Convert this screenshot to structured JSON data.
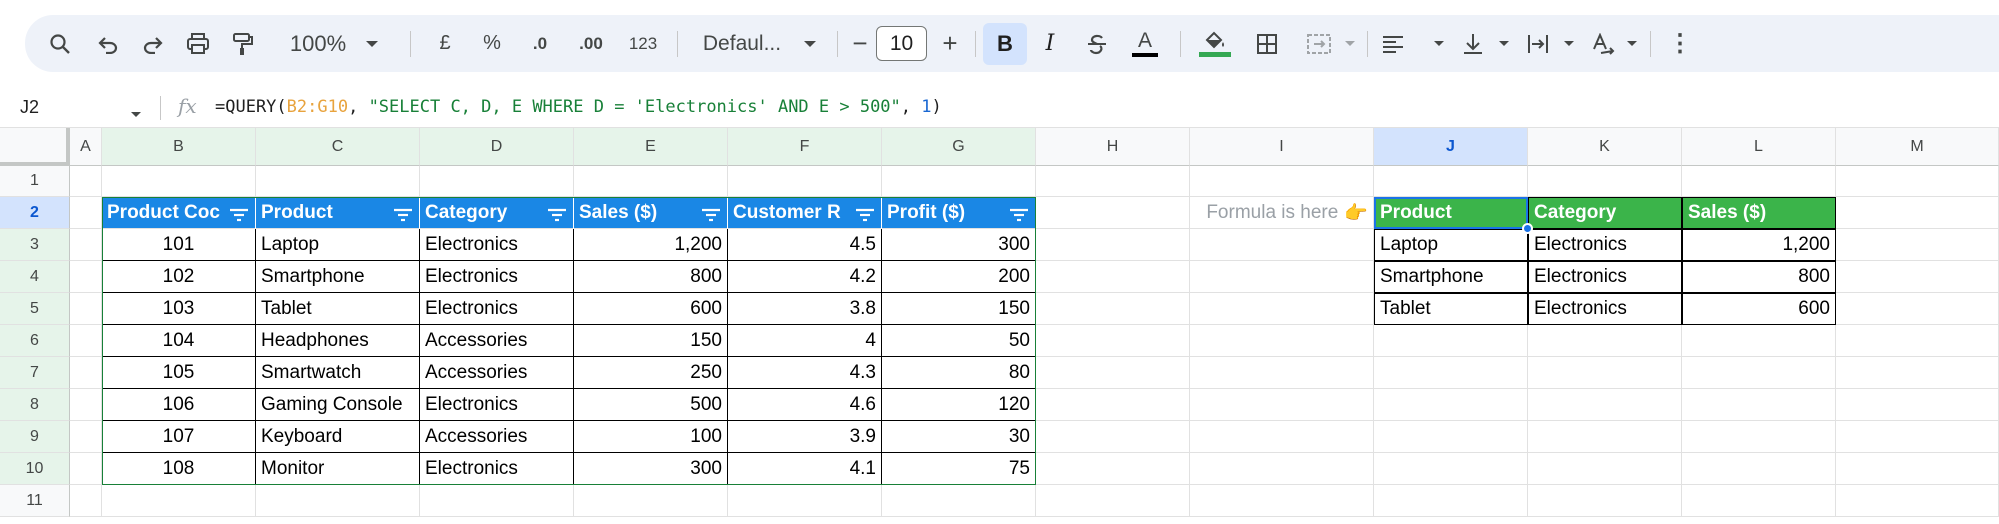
{
  "toolbar": {
    "zoom": "100%",
    "currency": "£",
    "percent": "%",
    "decrease_decimal": ".0",
    "increase_decimal": ".00",
    "number_format": "123",
    "font": "Defaul...",
    "font_size": "10",
    "minus": "−",
    "plus": "+",
    "bold": "B",
    "italic": "I",
    "text_color": "A",
    "more": "⋮",
    "icons": [
      "search-icon",
      "undo-icon",
      "redo-icon",
      "print-icon",
      "paint-format-icon",
      "bold-icon",
      "italic-icon",
      "strikethrough-icon",
      "text-color-icon",
      "fill-color-icon",
      "borders-icon",
      "merge-cells-icon",
      "align-left-icon",
      "vertical-align-icon",
      "text-wrap-icon",
      "text-rotation-icon",
      "more-vert-icon"
    ]
  },
  "formula_bar": {
    "cell_ref": "J2",
    "fx": "fx",
    "formula_prefix": "=QUERY(",
    "formula_range": "B2:G10",
    "formula_sep1": ", ",
    "formula_string": "\"SELECT C, D, E WHERE D = 'Electronics' AND E > 500\"",
    "formula_sep2": ", ",
    "formula_num": "1",
    "formula_close": ")"
  },
  "columns": [
    "A",
    "B",
    "C",
    "D",
    "E",
    "F",
    "G",
    "H",
    "I",
    "J",
    "K",
    "L",
    "M"
  ],
  "rows": [
    "1",
    "2",
    "3",
    "4",
    "5",
    "6",
    "7",
    "8",
    "9",
    "10",
    "11"
  ],
  "source_table": {
    "headers": [
      "Product Code",
      "Product",
      "Category",
      "Sales ($)",
      "Customer Rating",
      "Profit ($)"
    ],
    "header_visible": [
      "Product Coc",
      "Product",
      "Category",
      "Sales ($)",
      "Customer R",
      "Profit ($)"
    ],
    "rows": [
      [
        "101",
        "Laptop",
        "Electronics",
        "1,200",
        "4.5",
        "300"
      ],
      [
        "102",
        "Smartphone",
        "Electronics",
        "800",
        "4.2",
        "200"
      ],
      [
        "103",
        "Tablet",
        "Electronics",
        "600",
        "3.8",
        "150"
      ],
      [
        "104",
        "Headphones",
        "Accessories",
        "150",
        "4",
        "50"
      ],
      [
        "105",
        "Smartwatch",
        "Accessories",
        "250",
        "4.3",
        "80"
      ],
      [
        "106",
        "Gaming Console",
        "Electronics",
        "500",
        "4.6",
        "120"
      ],
      [
        "107",
        "Keyboard",
        "Accessories",
        "100",
        "3.9",
        "30"
      ],
      [
        "108",
        "Monitor",
        "Electronics",
        "300",
        "4.1",
        "75"
      ]
    ]
  },
  "note": {
    "text": "Formula is here",
    "emoji": "👉"
  },
  "result_table": {
    "headers": [
      "Product",
      "Category",
      "Sales ($)"
    ],
    "rows": [
      [
        "Laptop",
        "Electronics",
        "1,200"
      ],
      [
        "Smartphone",
        "Electronics",
        "800"
      ],
      [
        "Tablet",
        "Electronics",
        "600"
      ]
    ]
  },
  "colors": {
    "source_header_bg": "#1a87e5",
    "result_header_bg": "#3bb44a",
    "selection_blue": "#1a73e8",
    "range_green": "#188038"
  }
}
